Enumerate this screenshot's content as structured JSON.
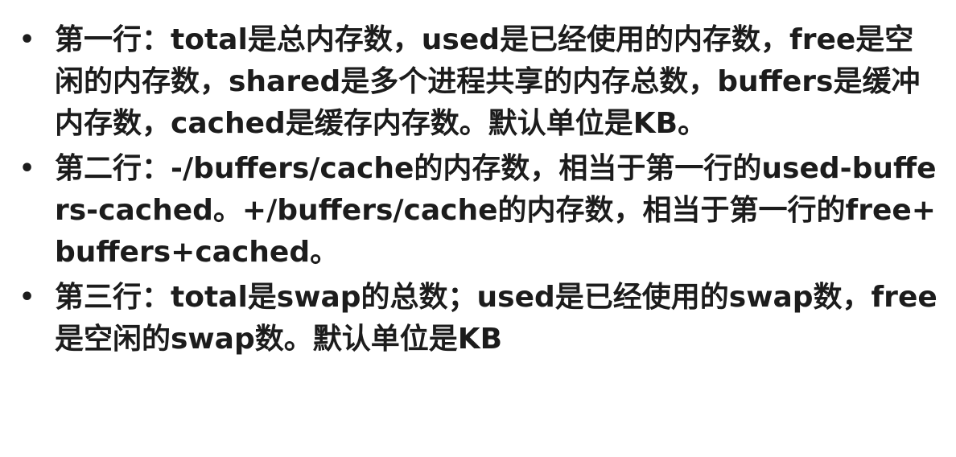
{
  "slide": {
    "bullets": [
      {
        "marker": "•",
        "text": "第一行：total是总内存数，used是已经使用的内存数，free是空闲的内存数，shared是多个进程共享的内存总数，buffers是缓冲内存数，cached是缓存内存数。默认单位是KB。"
      },
      {
        "marker": "•",
        "text": "第二行：-/buffers/cache的内存数，相当于第一行的used-buffers-cached。+/buffers/cache的内存数，相当于第一行的free+buffers+cached。"
      },
      {
        "marker": "•",
        "text": "第三行：total是swap的总数；used是已经使用的swap数，free是空闲的swap数。默认单位是KB"
      }
    ]
  }
}
